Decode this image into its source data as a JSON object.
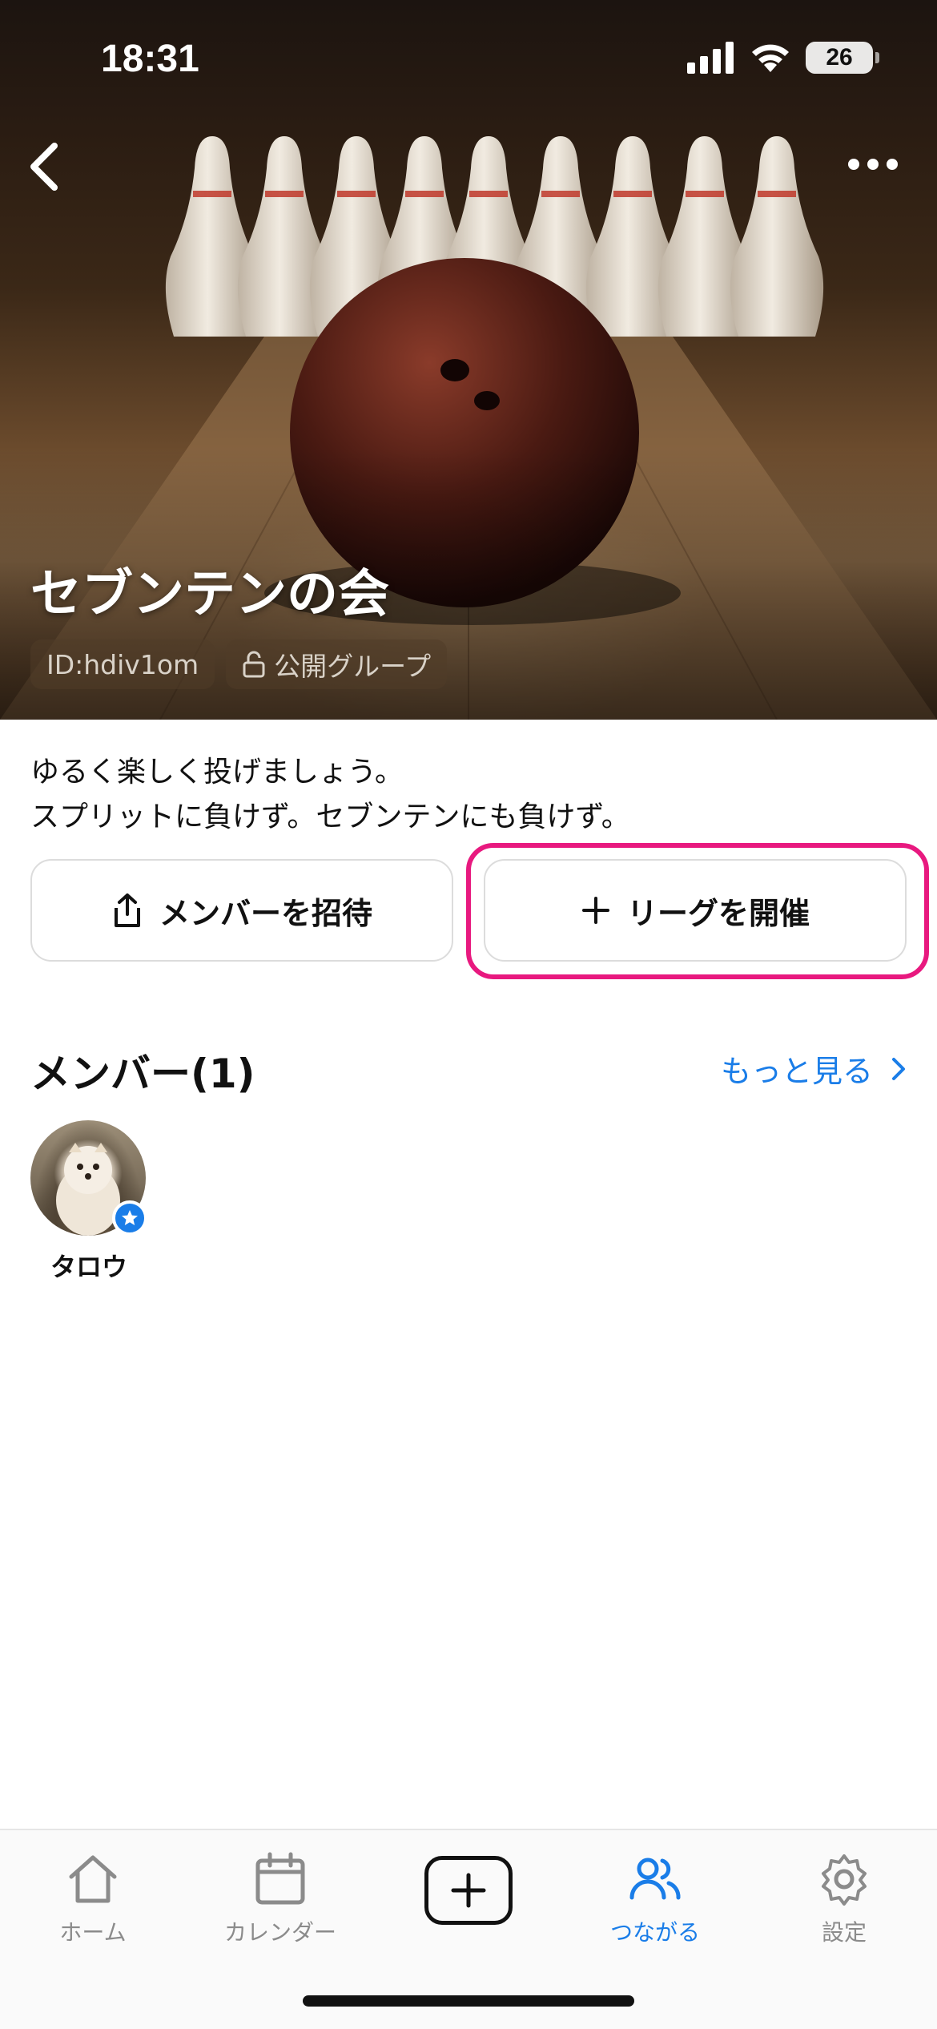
{
  "status_bar": {
    "time": "18:31",
    "battery": "26",
    "icons": [
      "cellular-signal-icon",
      "wifi-icon",
      "battery-icon"
    ]
  },
  "header": {
    "back_icon": "chevron-left-icon",
    "more_icon": "ellipsis-icon"
  },
  "group": {
    "name": "セブンテンの会",
    "id_label": "ID:hdiv1om",
    "visibility_label": "公開グループ",
    "visibility_icon": "unlock-icon",
    "description_lines": [
      "ゆるく楽しく投げましょう。",
      "スプリットに負けず。セブンテンにも負けず。"
    ]
  },
  "actions": {
    "invite_label": "メンバーを招待",
    "invite_icon": "share-icon",
    "league_label": "リーグを開催",
    "league_icon": "plus-icon",
    "highlight_color": "#e8197f"
  },
  "members": {
    "title": "メンバー(1)",
    "more_label": "もっと見る",
    "list": [
      {
        "name": "タロウ",
        "badge_icon": "star-icon"
      }
    ]
  },
  "tabbar": {
    "tabs": [
      {
        "label": "ホーム",
        "icon": "home-icon",
        "active": false
      },
      {
        "label": "カレンダー",
        "icon": "calendar-icon",
        "active": false
      },
      {
        "label": "",
        "icon": "add-icon",
        "active": false
      },
      {
        "label": "つながる",
        "icon": "people-icon",
        "active": true
      },
      {
        "label": "設定",
        "icon": "gear-icon",
        "active": false
      }
    ]
  },
  "colors": {
    "accent": "#1a7de8",
    "highlight": "#e8197f"
  }
}
